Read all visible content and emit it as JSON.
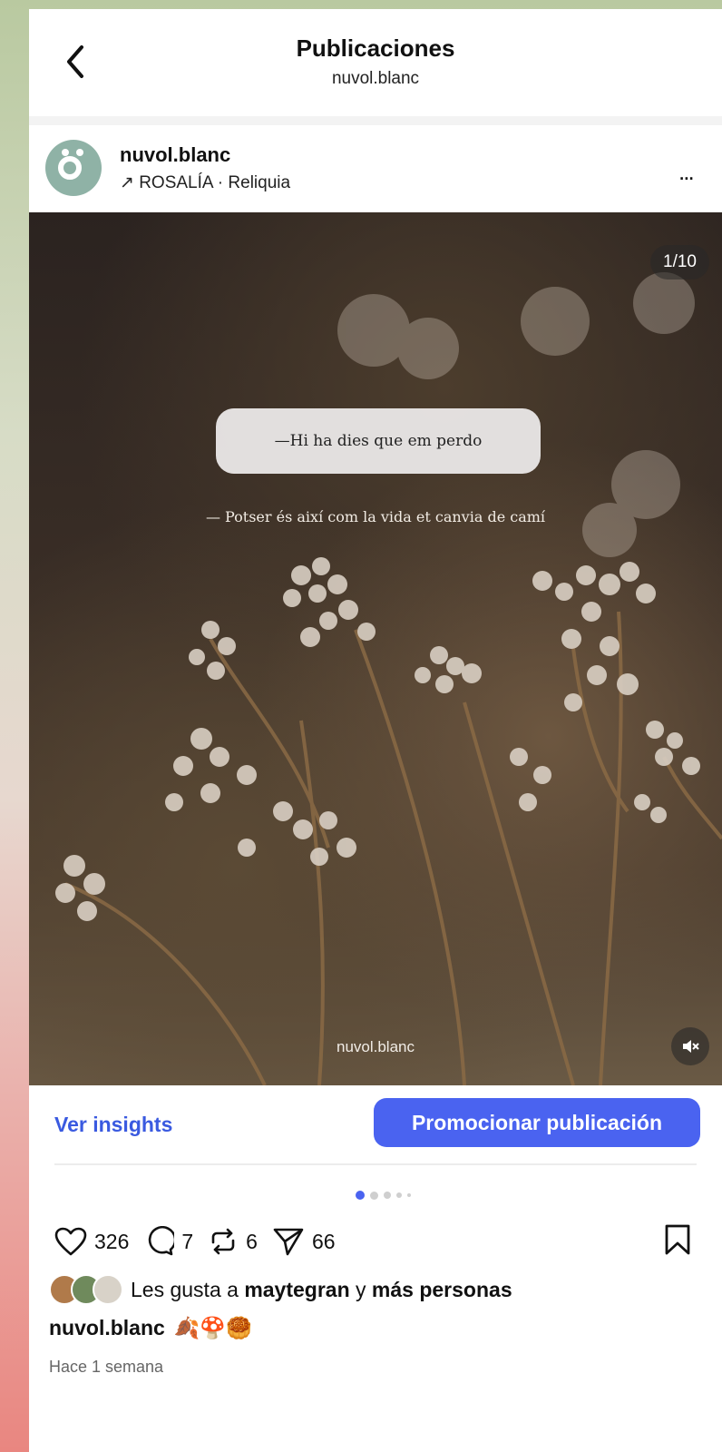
{
  "header": {
    "title": "Publicaciones",
    "subtitle": "nuvol.blanc"
  },
  "post": {
    "username": "nuvol.blanc",
    "music": "↗ ROSALÍA · Reliquia",
    "more_label": "...",
    "media": {
      "counter": "1/10",
      "quote_box": "—Hi ha dies que em perdo",
      "quote_line": "— Potser és així com la vida et canvia de camí",
      "watermark": "nuvol.blanc",
      "mute_icon": "speaker-muted-icon"
    }
  },
  "actions": {
    "insights_label": "Ver insights",
    "promote_label": "Promocionar publicación",
    "carousel_position": 1,
    "carousel_total": 10
  },
  "stats": {
    "likes": "326",
    "comments": "7",
    "reposts": "6",
    "shares": "66"
  },
  "likes_line": {
    "prefix": "Les gusta a ",
    "user": "maytegran",
    "middle": " y ",
    "others": "más personas"
  },
  "caption": {
    "username": "nuvol.blanc",
    "emojis": "🍂🍄🥮"
  },
  "timestamp": "Hace 1 semana",
  "colors": {
    "accent": "#4a63f0",
    "link": "#3a5ae0"
  }
}
